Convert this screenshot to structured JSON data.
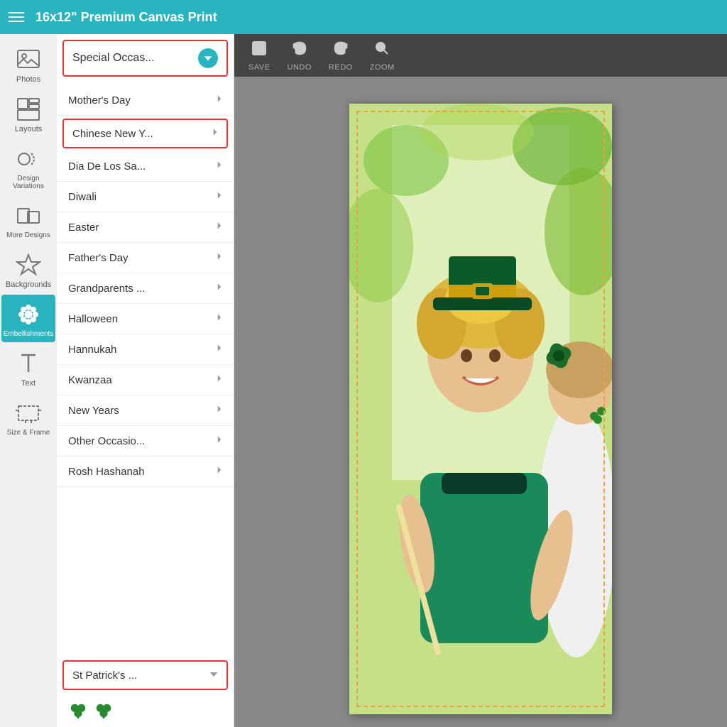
{
  "topbar": {
    "title": "16x12\" Premium Canvas Print"
  },
  "sidebar": {
    "items": [
      {
        "id": "photos",
        "label": "Photos",
        "icon": "photo-icon"
      },
      {
        "id": "layouts",
        "label": "Layouts",
        "icon": "layouts-icon"
      },
      {
        "id": "design-variations",
        "label": "Design Variations",
        "icon": "design-icon"
      },
      {
        "id": "more-designs",
        "label": "More Designs",
        "icon": "more-designs-icon"
      },
      {
        "id": "backgrounds",
        "label": "Backgrounds",
        "icon": "backgrounds-icon"
      },
      {
        "id": "embellishments",
        "label": "Embellishments",
        "icon": "embellishments-icon",
        "active": true
      },
      {
        "id": "text",
        "label": "Text",
        "icon": "text-icon"
      },
      {
        "id": "size-frame",
        "label": "Size & Frame",
        "icon": "size-frame-icon"
      }
    ]
  },
  "panel": {
    "header": {
      "label": "Special Occas...",
      "chevron": "chevron-down"
    },
    "items": [
      {
        "id": "mothers-day",
        "label": "Mother's Day",
        "chevron": "right",
        "highlighted": false
      },
      {
        "id": "chinese-new-year",
        "label": "Chinese New Y...",
        "chevron": "right",
        "highlighted": true
      },
      {
        "id": "dia-de-los-sa",
        "label": "Dia De Los Sa...",
        "chevron": "right",
        "highlighted": false
      },
      {
        "id": "diwali",
        "label": "Diwali",
        "chevron": "right",
        "highlighted": false
      },
      {
        "id": "easter",
        "label": "Easter",
        "chevron": "right",
        "highlighted": false
      },
      {
        "id": "fathers-day",
        "label": "Father's Day",
        "chevron": "right",
        "highlighted": false
      },
      {
        "id": "grandparents",
        "label": "Grandparents ...",
        "chevron": "right",
        "highlighted": false
      },
      {
        "id": "halloween",
        "label": "Halloween",
        "chevron": "right",
        "highlighted": false
      },
      {
        "id": "hannukah",
        "label": "Hannukah",
        "chevron": "right",
        "highlighted": false
      },
      {
        "id": "kwanzaa",
        "label": "Kwanzaa",
        "chevron": "right",
        "highlighted": false
      },
      {
        "id": "new-years",
        "label": "New Years",
        "chevron": "right",
        "highlighted": false
      },
      {
        "id": "other-ocasio",
        "label": "Other Occasio...",
        "chevron": "right",
        "highlighted": false
      },
      {
        "id": "rosh-hashanah",
        "label": "Rosh Hashanah",
        "chevron": "right",
        "highlighted": false
      }
    ],
    "bottom_item": {
      "label": "St Patrick's ...",
      "chevron": "chevron-down"
    }
  },
  "toolbar": {
    "buttons": [
      {
        "id": "save",
        "label": "SAVE"
      },
      {
        "id": "undo",
        "label": "UNDO"
      },
      {
        "id": "redo",
        "label": "REDO"
      },
      {
        "id": "zoom",
        "label": "ZOOM"
      }
    ]
  }
}
